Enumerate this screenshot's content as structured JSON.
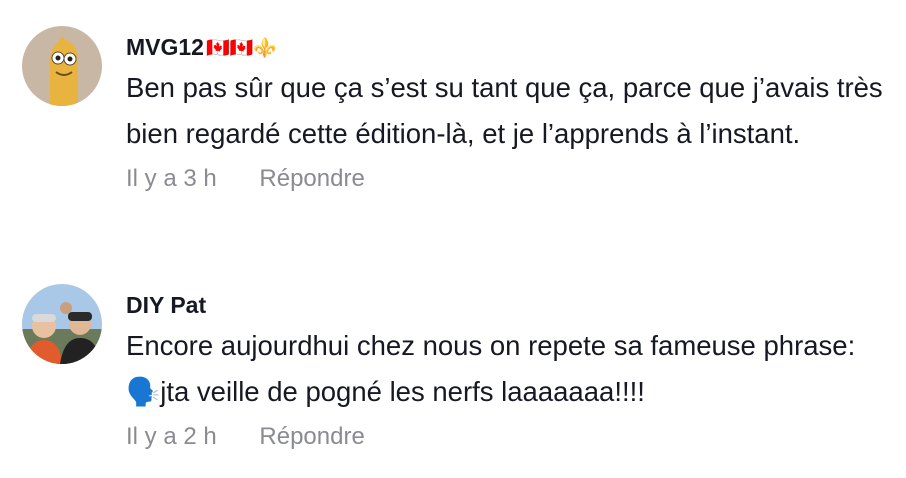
{
  "comments": [
    {
      "username": "MVG12",
      "username_badges": "🇨🇦🇨🇦⚜️",
      "text": "Ben pas sûr que ça s’est su tant que ça, parce que j’avais très bien regardé cette édition-là, et je l’apprends à l’instant.",
      "time": "Il y a 3 h",
      "reply_label": "Répondre",
      "avatar_icon": "cartoon-character-avatar"
    },
    {
      "username": "DIY Pat",
      "text": "Encore aujourdhui chez nous on repete sa fameuse phrase: 🗣️jta veille de pogné les nerfs laaaaaaa!!!!",
      "time": "Il y a 2 h",
      "reply_label": "Répondre",
      "avatar_icon": "family-photo-avatar"
    }
  ]
}
